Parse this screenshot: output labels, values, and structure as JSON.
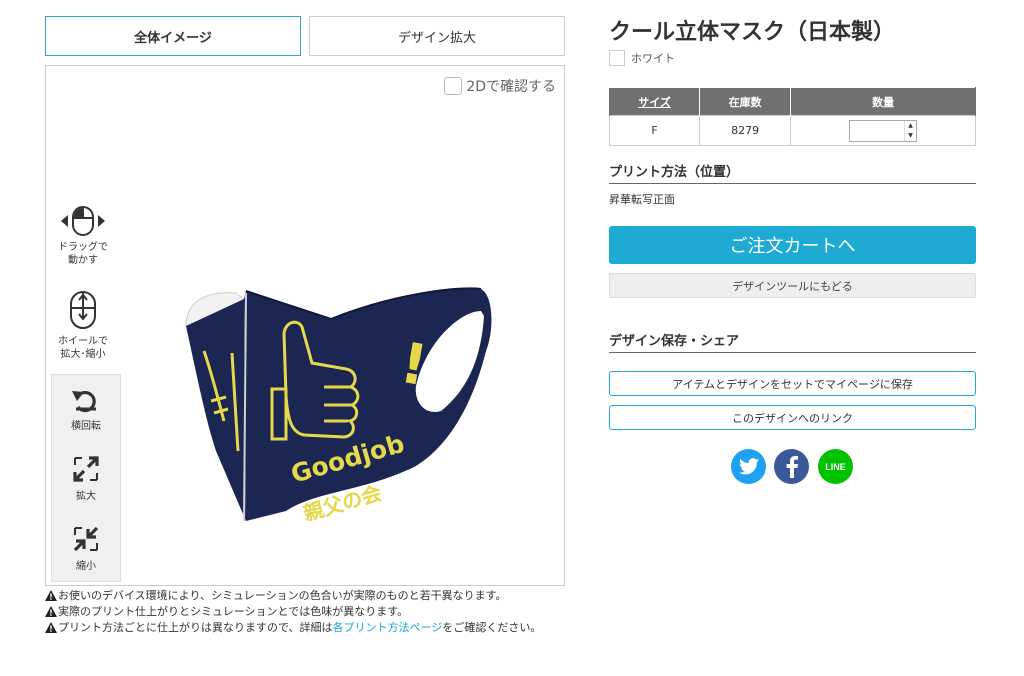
{
  "tabs": [
    {
      "label": "全体イメージ",
      "active": true
    },
    {
      "label": "デザイン拡大",
      "active": false
    }
  ],
  "viewer": {
    "check_2d_label": "2Dで確認する",
    "drag_hint": [
      "ドラッグで",
      "動かす"
    ],
    "wheel_hint": [
      "ホイールで",
      "拡大･縮小"
    ],
    "tools": {
      "rotate": "横回転",
      "zoom_in": "拡大",
      "zoom_out": "縮小"
    },
    "print_texts": [
      "Goodjob",
      "!",
      "親父の会"
    ]
  },
  "notes": {
    "note1": "お使いのデバイス環境により、シミュレーションの色合いが実際のものと若干異なります。",
    "note2": "実際のプリント仕上がりとシミュレーションとでは色味が異なります。",
    "note3_before": "プリント方法ごとに仕上がりは異なりますので、詳細は",
    "note3_link": "各プリント方法ページ",
    "note3_after": "をご確認ください。"
  },
  "product": {
    "title": "クール立体マスク（日本製）",
    "color_name": "ホワイト"
  },
  "stock_table": {
    "headers": [
      "サイズ",
      "在庫数",
      "数量"
    ],
    "rows": [
      {
        "size": "F",
        "stock": "8279",
        "quantity": ""
      }
    ]
  },
  "print_section": {
    "heading": "プリント方法（位置）",
    "method": "昇華転写正面"
  },
  "buttons": {
    "cart": "ご注文カートへ",
    "back_to_tool": "デザインツールにもどる",
    "save": "アイテムとデザインをセットでマイページに保存",
    "link": "このデザインへのリンク"
  },
  "save_section": {
    "heading": "デザイン保存・シェア"
  },
  "share": {
    "line_label": "LINE"
  },
  "colors": {
    "accent": "#1eaad3",
    "mask_navy": "#1b2752",
    "print_yellow": "#e5d84a",
    "table_header": "#707070"
  }
}
